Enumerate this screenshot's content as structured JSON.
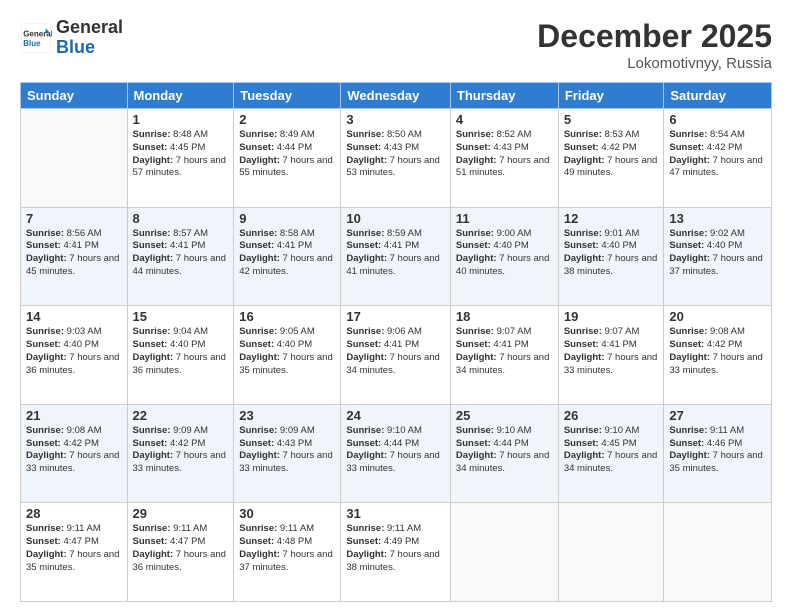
{
  "logo": {
    "general": "General",
    "blue": "Blue"
  },
  "header": {
    "month": "December 2025",
    "location": "Lokomotivnyy, Russia"
  },
  "weekdays": [
    "Sunday",
    "Monday",
    "Tuesday",
    "Wednesday",
    "Thursday",
    "Friday",
    "Saturday"
  ],
  "weeks": [
    [
      {
        "day": "",
        "sunrise": "",
        "sunset": "",
        "daylight": ""
      },
      {
        "day": "1",
        "sunrise": "8:48 AM",
        "sunset": "4:45 PM",
        "daylight": "7 hours and 57 minutes."
      },
      {
        "day": "2",
        "sunrise": "8:49 AM",
        "sunset": "4:44 PM",
        "daylight": "7 hours and 55 minutes."
      },
      {
        "day": "3",
        "sunrise": "8:50 AM",
        "sunset": "4:43 PM",
        "daylight": "7 hours and 53 minutes."
      },
      {
        "day": "4",
        "sunrise": "8:52 AM",
        "sunset": "4:43 PM",
        "daylight": "7 hours and 51 minutes."
      },
      {
        "day": "5",
        "sunrise": "8:53 AM",
        "sunset": "4:42 PM",
        "daylight": "7 hours and 49 minutes."
      },
      {
        "day": "6",
        "sunrise": "8:54 AM",
        "sunset": "4:42 PM",
        "daylight": "7 hours and 47 minutes."
      }
    ],
    [
      {
        "day": "7",
        "sunrise": "8:56 AM",
        "sunset": "4:41 PM",
        "daylight": "7 hours and 45 minutes."
      },
      {
        "day": "8",
        "sunrise": "8:57 AM",
        "sunset": "4:41 PM",
        "daylight": "7 hours and 44 minutes."
      },
      {
        "day": "9",
        "sunrise": "8:58 AM",
        "sunset": "4:41 PM",
        "daylight": "7 hours and 42 minutes."
      },
      {
        "day": "10",
        "sunrise": "8:59 AM",
        "sunset": "4:41 PM",
        "daylight": "7 hours and 41 minutes."
      },
      {
        "day": "11",
        "sunrise": "9:00 AM",
        "sunset": "4:40 PM",
        "daylight": "7 hours and 40 minutes."
      },
      {
        "day": "12",
        "sunrise": "9:01 AM",
        "sunset": "4:40 PM",
        "daylight": "7 hours and 38 minutes."
      },
      {
        "day": "13",
        "sunrise": "9:02 AM",
        "sunset": "4:40 PM",
        "daylight": "7 hours and 37 minutes."
      }
    ],
    [
      {
        "day": "14",
        "sunrise": "9:03 AM",
        "sunset": "4:40 PM",
        "daylight": "7 hours and 36 minutes."
      },
      {
        "day": "15",
        "sunrise": "9:04 AM",
        "sunset": "4:40 PM",
        "daylight": "7 hours and 36 minutes."
      },
      {
        "day": "16",
        "sunrise": "9:05 AM",
        "sunset": "4:40 PM",
        "daylight": "7 hours and 35 minutes."
      },
      {
        "day": "17",
        "sunrise": "9:06 AM",
        "sunset": "4:41 PM",
        "daylight": "7 hours and 34 minutes."
      },
      {
        "day": "18",
        "sunrise": "9:07 AM",
        "sunset": "4:41 PM",
        "daylight": "7 hours and 34 minutes."
      },
      {
        "day": "19",
        "sunrise": "9:07 AM",
        "sunset": "4:41 PM",
        "daylight": "7 hours and 33 minutes."
      },
      {
        "day": "20",
        "sunrise": "9:08 AM",
        "sunset": "4:42 PM",
        "daylight": "7 hours and 33 minutes."
      }
    ],
    [
      {
        "day": "21",
        "sunrise": "9:08 AM",
        "sunset": "4:42 PM",
        "daylight": "7 hours and 33 minutes."
      },
      {
        "day": "22",
        "sunrise": "9:09 AM",
        "sunset": "4:42 PM",
        "daylight": "7 hours and 33 minutes."
      },
      {
        "day": "23",
        "sunrise": "9:09 AM",
        "sunset": "4:43 PM",
        "daylight": "7 hours and 33 minutes."
      },
      {
        "day": "24",
        "sunrise": "9:10 AM",
        "sunset": "4:44 PM",
        "daylight": "7 hours and 33 minutes."
      },
      {
        "day": "25",
        "sunrise": "9:10 AM",
        "sunset": "4:44 PM",
        "daylight": "7 hours and 34 minutes."
      },
      {
        "day": "26",
        "sunrise": "9:10 AM",
        "sunset": "4:45 PM",
        "daylight": "7 hours and 34 minutes."
      },
      {
        "day": "27",
        "sunrise": "9:11 AM",
        "sunset": "4:46 PM",
        "daylight": "7 hours and 35 minutes."
      }
    ],
    [
      {
        "day": "28",
        "sunrise": "9:11 AM",
        "sunset": "4:47 PM",
        "daylight": "7 hours and 35 minutes."
      },
      {
        "day": "29",
        "sunrise": "9:11 AM",
        "sunset": "4:47 PM",
        "daylight": "7 hours and 36 minutes."
      },
      {
        "day": "30",
        "sunrise": "9:11 AM",
        "sunset": "4:48 PM",
        "daylight": "7 hours and 37 minutes."
      },
      {
        "day": "31",
        "sunrise": "9:11 AM",
        "sunset": "4:49 PM",
        "daylight": "7 hours and 38 minutes."
      },
      {
        "day": "",
        "sunrise": "",
        "sunset": "",
        "daylight": ""
      },
      {
        "day": "",
        "sunrise": "",
        "sunset": "",
        "daylight": ""
      },
      {
        "day": "",
        "sunrise": "",
        "sunset": "",
        "daylight": ""
      }
    ]
  ],
  "labels": {
    "sunrise": "Sunrise:",
    "sunset": "Sunset:",
    "daylight": "Daylight:"
  }
}
